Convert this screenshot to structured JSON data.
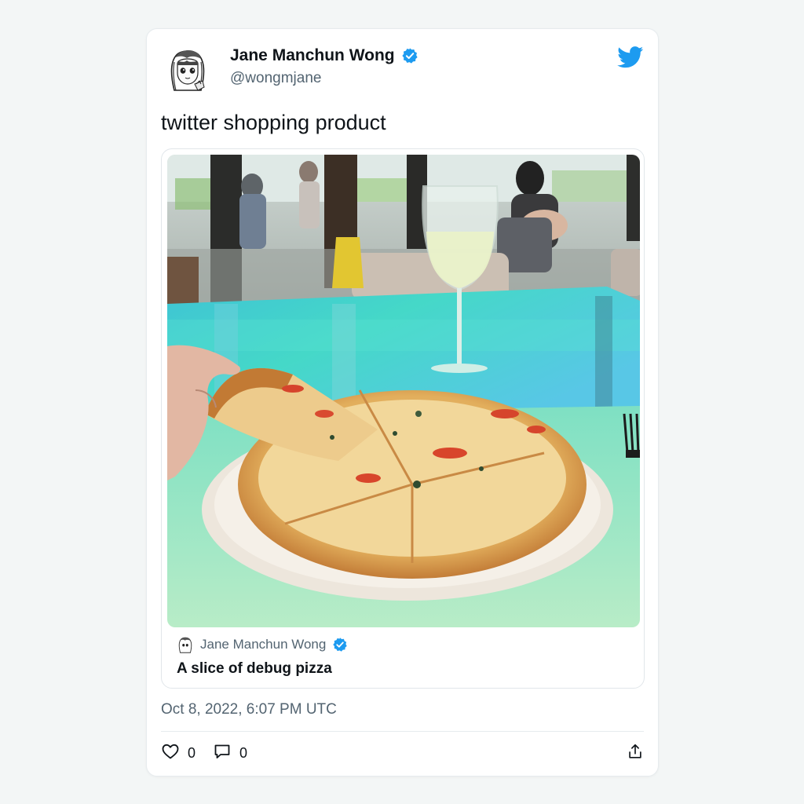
{
  "tweet": {
    "author_name": "Jane Manchun Wong",
    "author_handle": "@wongmjane",
    "text": "twitter shopping product",
    "timestamp": "Oct 8, 2022, 6:07 PM UTC",
    "likes": "0",
    "replies": "0"
  },
  "quote": {
    "author_name": "Jane Manchun Wong",
    "text": "A slice of debug pizza"
  },
  "icons": {
    "verified": "verified-badge-icon",
    "brand": "twitter-bird-icon",
    "like": "heart-icon",
    "reply": "speech-bubble-icon",
    "share": "share-icon"
  },
  "colors": {
    "brand": "#1d9bf0",
    "text": "#0f1419",
    "muted": "#536471"
  }
}
